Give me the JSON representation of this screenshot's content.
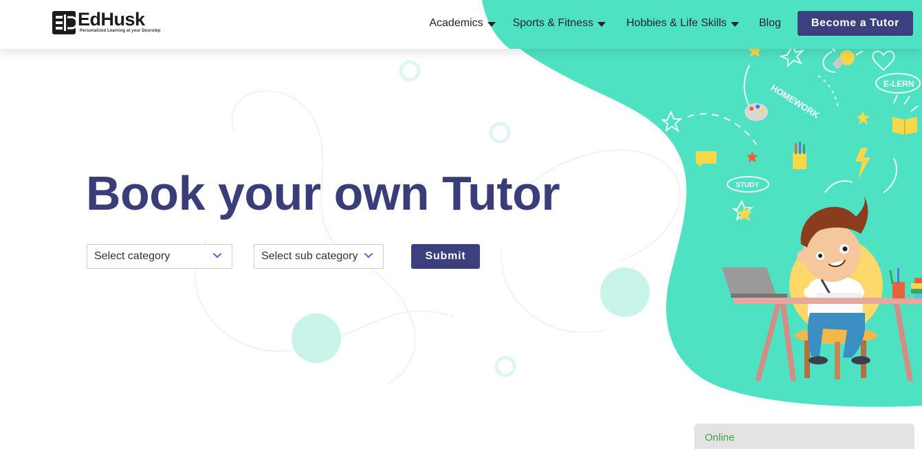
{
  "brand": {
    "name": "EdHusk",
    "tagline": "Personalized Learning at your Doorstep"
  },
  "nav": {
    "academics": "Academics",
    "sports": "Sports & Fitness",
    "hobbies": "Hobbies & Life Skills",
    "blog": "Blog",
    "become_tutor": "Become a Tutor"
  },
  "hero": {
    "title": "Book your own Tutor",
    "category_select": "Select category",
    "subcategory_select": "Select sub category",
    "submit": "Submit"
  },
  "illustration_words": {
    "homework": "HOMEWORK",
    "elearn": "E-LERN",
    "study": "STUDY"
  },
  "chat": {
    "status": "Online"
  },
  "colors": {
    "brand_navy": "#3b3f7c",
    "title_navy": "#393d7a",
    "accent_mint": "#4ee2c2",
    "online_green": "#3ea544",
    "chevron_purple": "#7b5ce0"
  }
}
